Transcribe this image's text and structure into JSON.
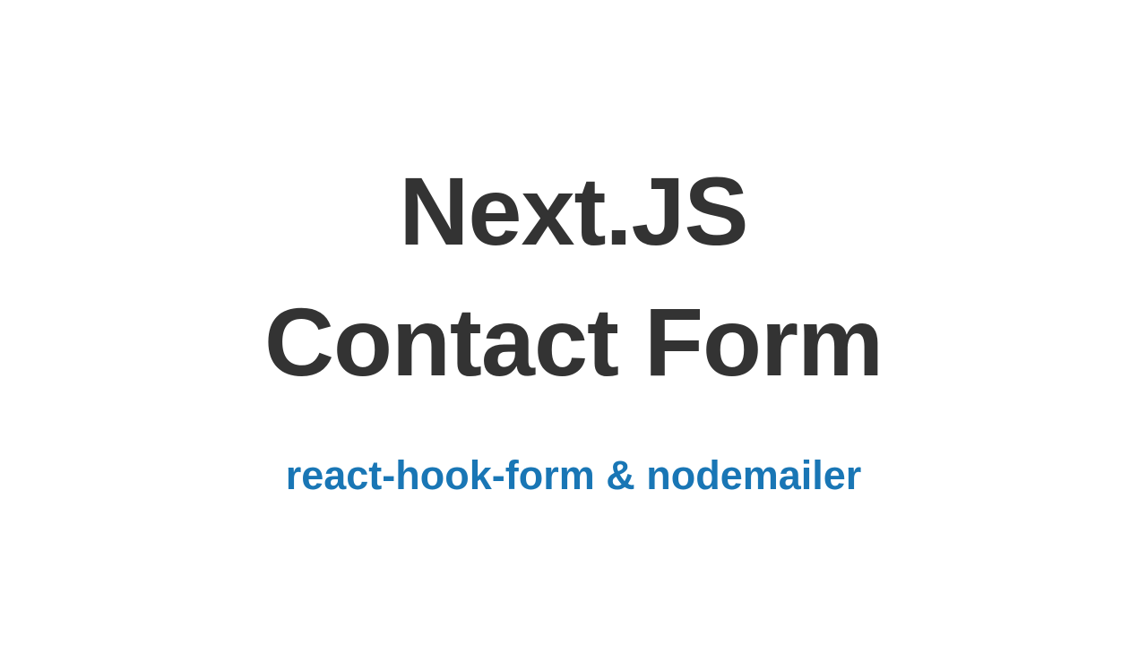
{
  "title_line1": "Next.JS",
  "title_line2": "Contact Form",
  "subtitle": "react-hook-form & nodemailer"
}
